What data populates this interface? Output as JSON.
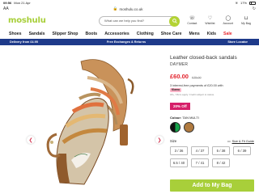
{
  "status": {
    "time": "09:56",
    "date": "Mon 21 Apr",
    "battery": "17%"
  },
  "browser": {
    "aa": "AA",
    "url": "moshulu.co.uk"
  },
  "header": {
    "logo": "moshulu",
    "search_placeholder": "What can we help you find?",
    "icons": [
      {
        "label": "Contact",
        "icon": "phone-icon"
      },
      {
        "label": "Wishlist",
        "icon": "heart-icon"
      },
      {
        "label": "Account",
        "icon": "user-icon"
      },
      {
        "label": "My Bag",
        "icon": "bag-icon"
      }
    ]
  },
  "nav": [
    "Shoes",
    "Sandals",
    "Slipper Shop",
    "Boots",
    "Accessories",
    "Clothing",
    "Shoe Care",
    "Mens",
    "Kids",
    "Sale"
  ],
  "promo": [
    "Delivery from £4.95",
    "Free Exchanges & Returns",
    "Store Locator"
  ],
  "product": {
    "title": "Leather closed-back sandals",
    "brand": "DAYMER",
    "price": "£60.00",
    "was_price": "£75.00",
    "klarna_text": "3 interest-free payments of £20.00 with",
    "klarna_badge": "Klarna",
    "klarna_learn": "18+, T&Cs apply. Credit subject to status.",
    "discount": "20% Off",
    "colour_label": "Colour:",
    "colour_value": "TAN MULTI",
    "size_label": "Size",
    "size_guide": "Size & Fit Guide",
    "sizes": [
      "3 / 36",
      "4 / 37",
      "5 / 38",
      "6 / 39",
      "6.5 / 40",
      "7 / 41",
      "8 / 42"
    ],
    "add_to_bag": "Add to My Bag"
  },
  "colors": {
    "brand_green": "#a8cf3a",
    "promo_blue": "#1e3a8a",
    "price_red": "#e2212b",
    "discount_pink": "#d61f69",
    "arrow_pink": "#d1324e"
  }
}
